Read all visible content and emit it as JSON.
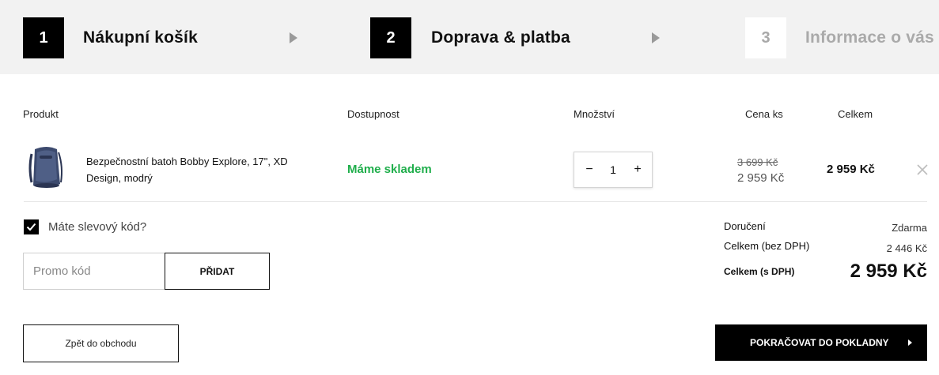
{
  "steps": [
    {
      "number": "1",
      "title": "Nákupní košík"
    },
    {
      "number": "2",
      "title": "Doprava & platba"
    },
    {
      "number": "3",
      "title": "Informace o vás"
    }
  ],
  "table": {
    "headers": {
      "product": "Produkt",
      "availability": "Dostupnost",
      "quantity": "Množství",
      "unit_price": "Cena ks",
      "total": "Celkem"
    }
  },
  "item": {
    "name": "Bezpečnostní batoh Bobby Explore, 17\", XD Design, modrý",
    "availability": "Máme skladem",
    "quantity": "1",
    "minus": "−",
    "plus": "+",
    "price_old": "3 699 Kč",
    "price_new": "2 959 Kč",
    "price_total": "2 959 Kč"
  },
  "discount": {
    "label": "Máte slevový kód?",
    "placeholder": "Promo kód",
    "button": "PŘIDAT"
  },
  "summary": {
    "delivery_label": "Doručení",
    "delivery_value": "Zdarma",
    "net_label": "Celkem (bez DPH)",
    "net_value": "2 446 Kč",
    "total_label": "Celkem (s DPH)",
    "total_value": "2 959 Kč"
  },
  "buttons": {
    "back": "Zpět do obchodu",
    "checkout": "POKRAČOVAT DO POKLADNY"
  },
  "colors": {
    "availability_green": "#1fae4b",
    "header_bg": "#f2f2f2",
    "primary": "#000000"
  }
}
